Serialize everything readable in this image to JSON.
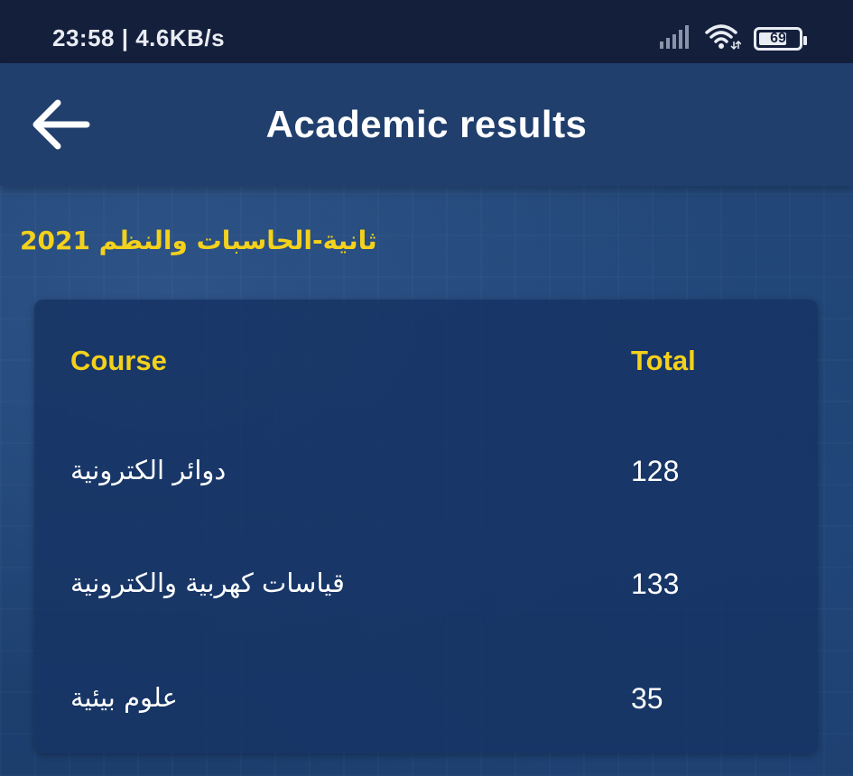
{
  "status_bar": {
    "time_speed": "23:58 | 4.6KB/s",
    "battery": "69",
    "icons": [
      "signal-icon",
      "wifi-icon",
      "battery-icon"
    ]
  },
  "app_bar": {
    "back_icon": "arrow-left-icon",
    "title": "Academic results"
  },
  "subtitle": "ثانية-الحاسبات والنظم 2021",
  "table": {
    "headers": {
      "course": "Course",
      "total": "Total"
    },
    "rows": [
      {
        "course": "دوائر الكترونية",
        "total": "128"
      },
      {
        "course": "قياسات كهربية والكترونية",
        "total": "133"
      },
      {
        "course": "علوم بيئية",
        "total": "35"
      }
    ]
  },
  "colors": {
    "accent": "#f4d11b",
    "status_bar": "#141f3c",
    "app_bar": "#203f6d",
    "card": "#163464"
  }
}
